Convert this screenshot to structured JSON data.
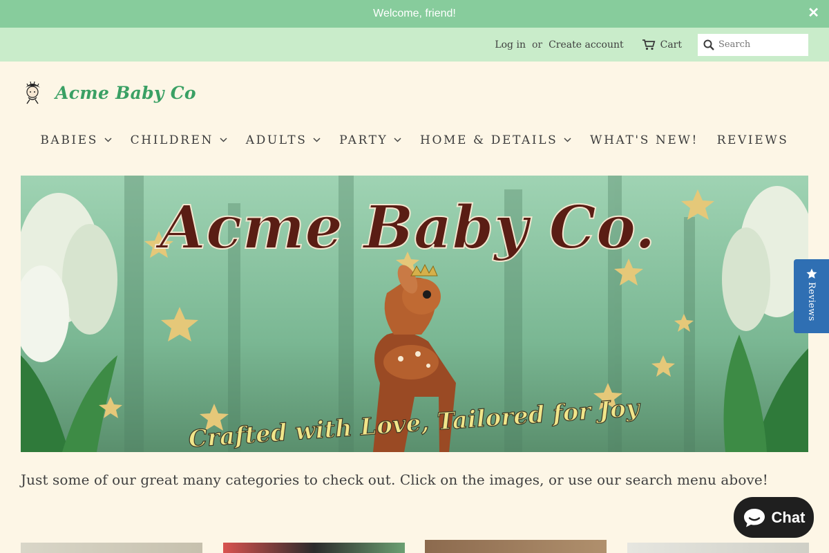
{
  "announcement": {
    "text": "Welcome, friend!",
    "close": "✕"
  },
  "topbar": {
    "login": "Log in",
    "or": "or",
    "create_account": "Create account",
    "cart": "Cart",
    "search_placeholder": "Search"
  },
  "brand": {
    "name": "Acme Baby Co"
  },
  "nav": {
    "items": [
      {
        "label": "BABIES",
        "has_dropdown": true
      },
      {
        "label": "CHILDREN",
        "has_dropdown": true
      },
      {
        "label": "ADULTS",
        "has_dropdown": true
      },
      {
        "label": "PARTY",
        "has_dropdown": true
      },
      {
        "label": "HOME & DETAILS",
        "has_dropdown": true
      },
      {
        "label": "WHAT'S NEW!",
        "has_dropdown": false
      },
      {
        "label": "REVIEWS",
        "has_dropdown": false
      }
    ]
  },
  "hero": {
    "title": "Acme Baby Co.",
    "tagline": "Crafted with Love, Tailored for Joy"
  },
  "intro": {
    "text": "Just some of our great many categories to check out. Click on the images, or use our search menu above!"
  },
  "reviews_tab": {
    "label": "Reviews"
  },
  "chat": {
    "label": "Chat"
  },
  "colors": {
    "announcement_bg": "#87cc9c",
    "topbar_bg": "#c9ecca",
    "page_bg": "#fdf6e6",
    "brand_green": "#3aa064",
    "reviews_blue": "#2f6fb3",
    "chat_bg": "#1f1f1f"
  }
}
